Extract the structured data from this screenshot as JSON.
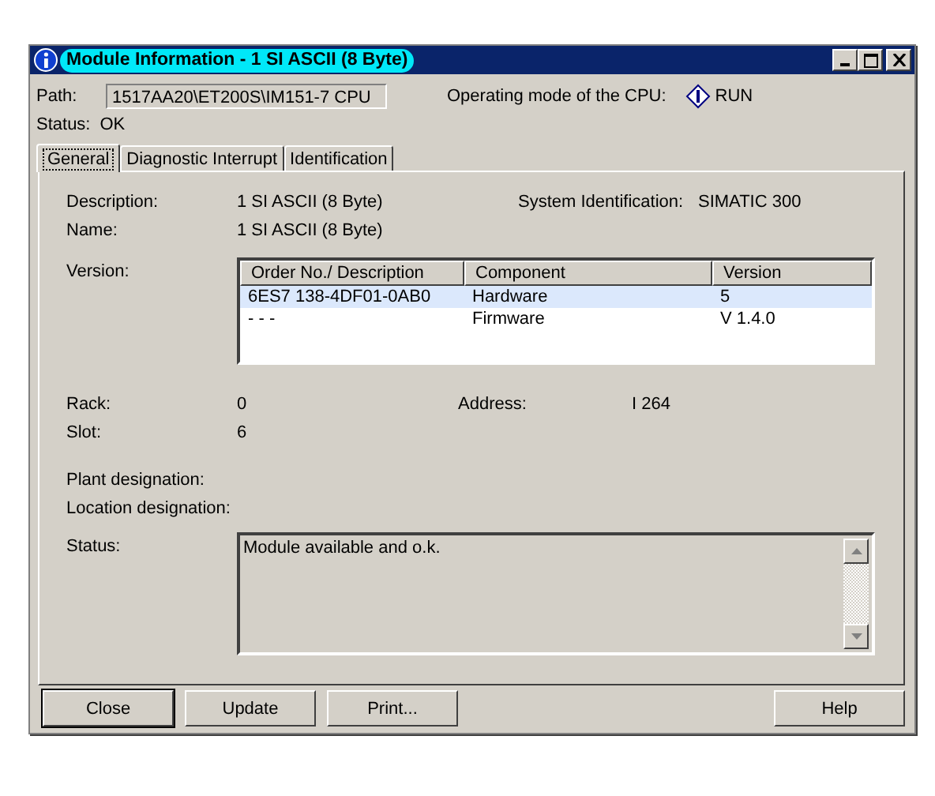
{
  "window": {
    "title": "Module Information - 1 SI  ASCII  (8 Byte)",
    "highlighted": true
  },
  "path": {
    "label": "Path:",
    "value": "1517AA20\\ET200S\\IM151-7 CPU"
  },
  "operating_mode": {
    "label": "Operating mode of the  CPU:",
    "value": "RUN"
  },
  "status_line": {
    "label": "Status:",
    "value": "OK"
  },
  "tabs": [
    {
      "label": "General",
      "selected": true
    },
    {
      "label": "Diagnostic Interrupt",
      "selected": false
    },
    {
      "label": "Identification",
      "selected": false
    }
  ],
  "general": {
    "description": {
      "label": "Description:",
      "value": "1 SI  ASCII  (8 Byte)"
    },
    "system_identification": {
      "label": "System Identification:",
      "value": "SIMATIC 300"
    },
    "name": {
      "label": "Name:",
      "value": "1 SI  ASCII  (8 Byte)"
    },
    "version": {
      "label": "Version:",
      "table": {
        "columns": [
          "Order No./ Description",
          "Component",
          "Version"
        ],
        "rows": [
          {
            "cells": [
              "6ES7 138-4DF01-0AB0",
              "Hardware",
              "5"
            ],
            "selected": true
          },
          {
            "cells": [
              "- - -",
              "Firmware",
              "V 1.4.0"
            ],
            "selected": false
          }
        ]
      }
    },
    "rack": {
      "label": "Rack:",
      "value": "0"
    },
    "address": {
      "label": "Address:",
      "value": "I 264"
    },
    "slot": {
      "label": "Slot:",
      "value": "6"
    },
    "plant_designation": {
      "label": "Plant designation:"
    },
    "location_designation": {
      "label": "Location designation:"
    },
    "status": {
      "label": "Status:",
      "value": "Module available and o.k."
    }
  },
  "buttons": [
    {
      "label": "Close",
      "default": true
    },
    {
      "label": "Update",
      "default": false
    },
    {
      "label": "Print...",
      "default": false
    },
    {
      "label": "Help",
      "default": false
    }
  ]
}
